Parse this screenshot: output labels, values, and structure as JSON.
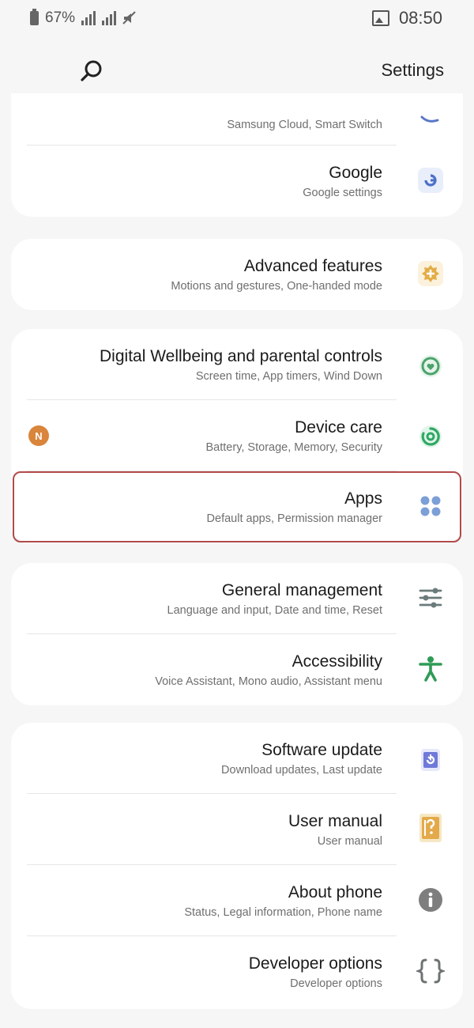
{
  "status_bar": {
    "battery_percent": "67%",
    "time": "08:50"
  },
  "header": {
    "title": "Settings"
  },
  "groups": [
    {
      "items": [
        {
          "title": "",
          "subtitle": "Samsung Cloud, Smart Switch",
          "icon": "accounts-key-icon"
        },
        {
          "title": "Google",
          "subtitle": "Google settings",
          "icon": "google-icon"
        }
      ]
    },
    {
      "items": [
        {
          "title": "Advanced features",
          "subtitle": "Motions and gestures, One-handed mode",
          "icon": "advanced-features-icon"
        }
      ]
    },
    {
      "items": [
        {
          "title": "Digital Wellbeing and parental controls",
          "subtitle": "Screen time, App timers, Wind Down",
          "icon": "digital-wellbeing-icon"
        },
        {
          "title": "Device care",
          "subtitle": "Battery, Storage, Memory, Security",
          "icon": "device-care-icon",
          "badge": "N"
        },
        {
          "title": "Apps",
          "subtitle": "Default apps, Permission manager",
          "icon": "apps-grid-icon"
        }
      ]
    },
    {
      "items": [
        {
          "title": "General management",
          "subtitle": "Language and input, Date and time, Reset",
          "icon": "sliders-icon"
        },
        {
          "title": "Accessibility",
          "subtitle": "Voice Assistant, Mono audio, Assistant menu",
          "icon": "accessibility-icon"
        }
      ]
    },
    {
      "items": [
        {
          "title": "Software update",
          "subtitle": "Download updates, Last update",
          "icon": "software-update-icon"
        },
        {
          "title": "User manual",
          "subtitle": "User manual",
          "icon": "user-manual-icon"
        },
        {
          "title": "About phone",
          "subtitle": "Status, Legal information, Phone name",
          "icon": "info-icon"
        },
        {
          "title": "Developer options",
          "subtitle": "Developer options",
          "icon": "developer-braces-icon"
        }
      ]
    }
  ],
  "colors": {
    "background": "#f6f6f6",
    "card": "#ffffff",
    "selection_outline": "#b24a4a",
    "badge": "#d9853b"
  }
}
